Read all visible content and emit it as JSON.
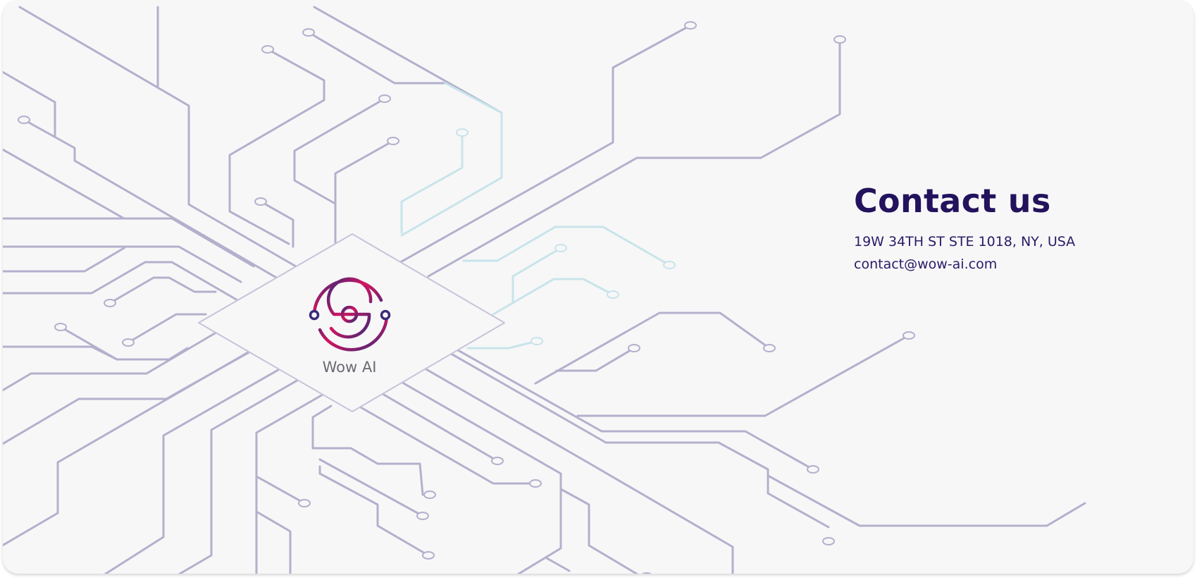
{
  "brand": {
    "name": "Wow AI",
    "logo_icon": "wow-ai-logo-icon",
    "colors": {
      "logo_magenta": "#d5145f",
      "logo_purple": "#3a2a7a",
      "title_purple": "#23125c",
      "circuit_purple": "#b3b0cc",
      "circuit_teal": "#c8e4ea",
      "background": "#f7f7f8"
    }
  },
  "contact": {
    "title": "Contact us",
    "address": "19W 34TH ST STE 1018, NY, USA",
    "email": "contact@wow-ai.com"
  }
}
